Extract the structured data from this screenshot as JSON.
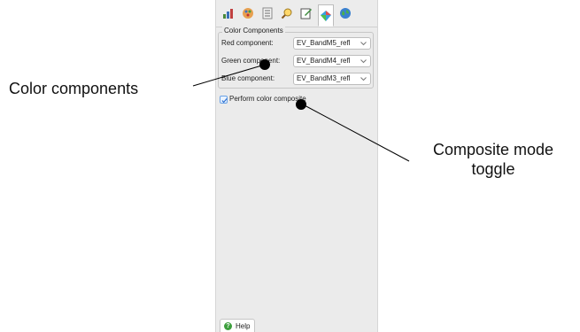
{
  "toolbar": {
    "icons": [
      "chart-icon",
      "palette-icon",
      "list-icon",
      "search-icon",
      "edit-icon",
      "color-composite-icon",
      "globe-icon"
    ],
    "active_index": 5
  },
  "color_components": {
    "title": "Color Components",
    "red_label": "Red component:",
    "red_value": "EV_BandM5_refl",
    "green_label": "Green component:",
    "green_value": "EV_BandM4_refl",
    "blue_label": "Blue component:",
    "blue_value": "EV_BandM3_refl"
  },
  "composite": {
    "label": "Perform color composite",
    "checked": true
  },
  "help": {
    "label": "Help"
  },
  "annotations": {
    "color_components": "Color components",
    "composite_line1": "Composite mode",
    "composite_line2": "toggle"
  },
  "colors": {
    "panel_bg": "#ebebeb",
    "checkbox_accent": "#6aa2e6",
    "help_icon": "#3d9f3d"
  }
}
